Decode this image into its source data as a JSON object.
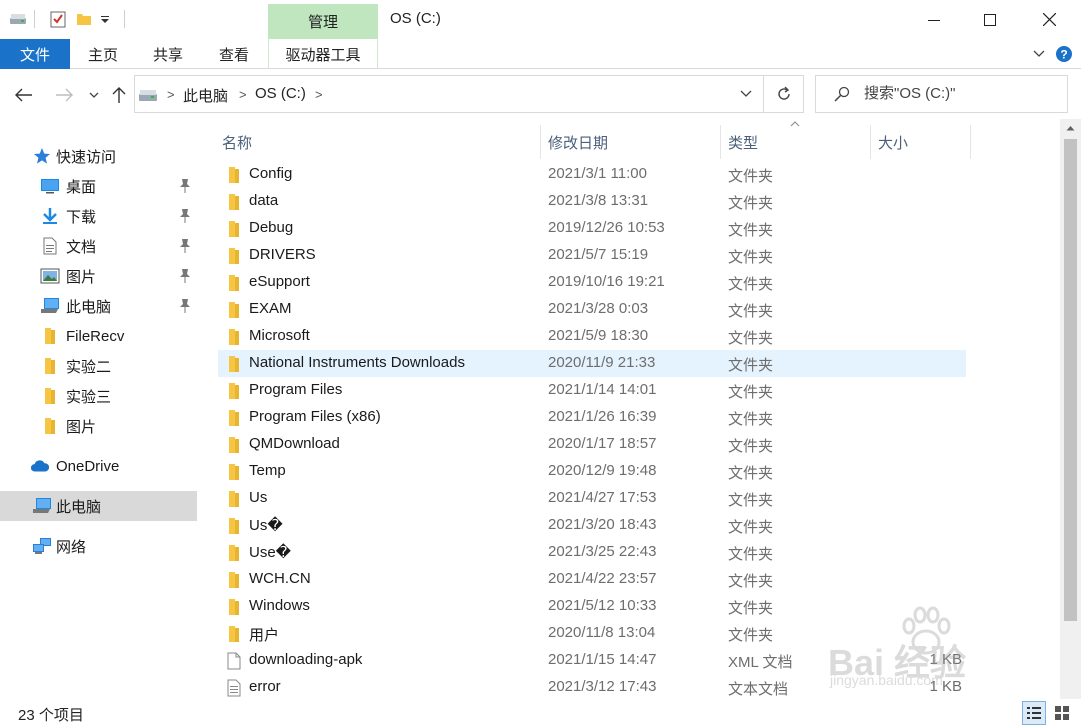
{
  "window": {
    "title": "OS (C:)",
    "manage_tab": "管理"
  },
  "ribbon": {
    "tabs": [
      "文件",
      "主页",
      "共享",
      "查看",
      "驱动器工具"
    ]
  },
  "address": {
    "crumbs": [
      "此电脑",
      "OS (C:)"
    ],
    "search_placeholder": "搜索\"OS (C:)\""
  },
  "sidebar": {
    "items": [
      {
        "label": "快速访问",
        "icon": "star-icon"
      },
      {
        "label": "桌面",
        "icon": "desktop-icon",
        "pinned": true
      },
      {
        "label": "下载",
        "icon": "download-icon",
        "pinned": true
      },
      {
        "label": "文档",
        "icon": "document-icon",
        "pinned": true
      },
      {
        "label": "图片",
        "icon": "pictures-icon",
        "pinned": true
      },
      {
        "label": "此电脑",
        "icon": "computer-icon",
        "pinned": true
      },
      {
        "label": "FileRecv",
        "icon": "folder-icon"
      },
      {
        "label": "实验二",
        "icon": "folder-icon"
      },
      {
        "label": "实验三",
        "icon": "folder-icon"
      },
      {
        "label": "图片",
        "icon": "folder-icon"
      },
      {
        "label": "OneDrive",
        "icon": "onedrive-icon"
      },
      {
        "label": "此电脑",
        "icon": "computer-icon",
        "selected": true
      },
      {
        "label": "网络",
        "icon": "network-icon"
      }
    ]
  },
  "columns": {
    "name": "名称",
    "date": "修改日期",
    "type": "类型",
    "size": "大小"
  },
  "files": [
    {
      "name": "Config",
      "date": "2021/3/1 11:00",
      "type": "文件夹",
      "size": "",
      "kind": "folder"
    },
    {
      "name": "data",
      "date": "2021/3/8 13:31",
      "type": "文件夹",
      "size": "",
      "kind": "folder"
    },
    {
      "name": "Debug",
      "date": "2019/12/26 10:53",
      "type": "文件夹",
      "size": "",
      "kind": "folder"
    },
    {
      "name": "DRIVERS",
      "date": "2021/5/7 15:19",
      "type": "文件夹",
      "size": "",
      "kind": "folder"
    },
    {
      "name": "eSupport",
      "date": "2019/10/16 19:21",
      "type": "文件夹",
      "size": "",
      "kind": "folder"
    },
    {
      "name": "EXAM",
      "date": "2021/3/28 0:03",
      "type": "文件夹",
      "size": "",
      "kind": "folder"
    },
    {
      "name": "Microsoft",
      "date": "2021/5/9 18:30",
      "type": "文件夹",
      "size": "",
      "kind": "folder"
    },
    {
      "name": "National Instruments Downloads",
      "date": "2020/11/9 21:33",
      "type": "文件夹",
      "size": "",
      "kind": "folder",
      "hover": true
    },
    {
      "name": "Program Files",
      "date": "2021/1/14 14:01",
      "type": "文件夹",
      "size": "",
      "kind": "folder"
    },
    {
      "name": "Program Files (x86)",
      "date": "2021/1/26 16:39",
      "type": "文件夹",
      "size": "",
      "kind": "folder"
    },
    {
      "name": "QMDownload",
      "date": "2020/1/17 18:57",
      "type": "文件夹",
      "size": "",
      "kind": "folder"
    },
    {
      "name": "Temp",
      "date": "2020/12/9 19:48",
      "type": "文件夹",
      "size": "",
      "kind": "folder"
    },
    {
      "name": "Us",
      "date": "2021/4/27 17:53",
      "type": "文件夹",
      "size": "",
      "kind": "folder"
    },
    {
      "name": "Us�",
      "date": "2021/3/20 18:43",
      "type": "文件夹",
      "size": "",
      "kind": "folder"
    },
    {
      "name": "Use�",
      "date": "2021/3/25 22:43",
      "type": "文件夹",
      "size": "",
      "kind": "folder"
    },
    {
      "name": "WCH.CN",
      "date": "2021/4/22 23:57",
      "type": "文件夹",
      "size": "",
      "kind": "folder"
    },
    {
      "name": "Windows",
      "date": "2021/5/12 10:33",
      "type": "文件夹",
      "size": "",
      "kind": "folder"
    },
    {
      "name": "用户",
      "date": "2020/11/8 13:04",
      "type": "文件夹",
      "size": "",
      "kind": "folder"
    },
    {
      "name": "downloading-apk",
      "date": "2021/1/15 14:47",
      "type": "XML 文档",
      "size": "1 KB",
      "kind": "xml"
    },
    {
      "name": "error",
      "date": "2021/3/12 17:43",
      "type": "文本文档",
      "size": "1 KB",
      "kind": "text"
    }
  ],
  "status": {
    "item_count": "23 个项目"
  },
  "watermark": {
    "brand": "Bai 经验",
    "url": "jingyan.baidu.com"
  },
  "colors": {
    "file_tab": "#1a73c8",
    "manage_tab": "#bfe6bf",
    "folder": "#f6c543",
    "hover_row": "#e5f3ff",
    "selected_nav": "#d9d9d9"
  }
}
